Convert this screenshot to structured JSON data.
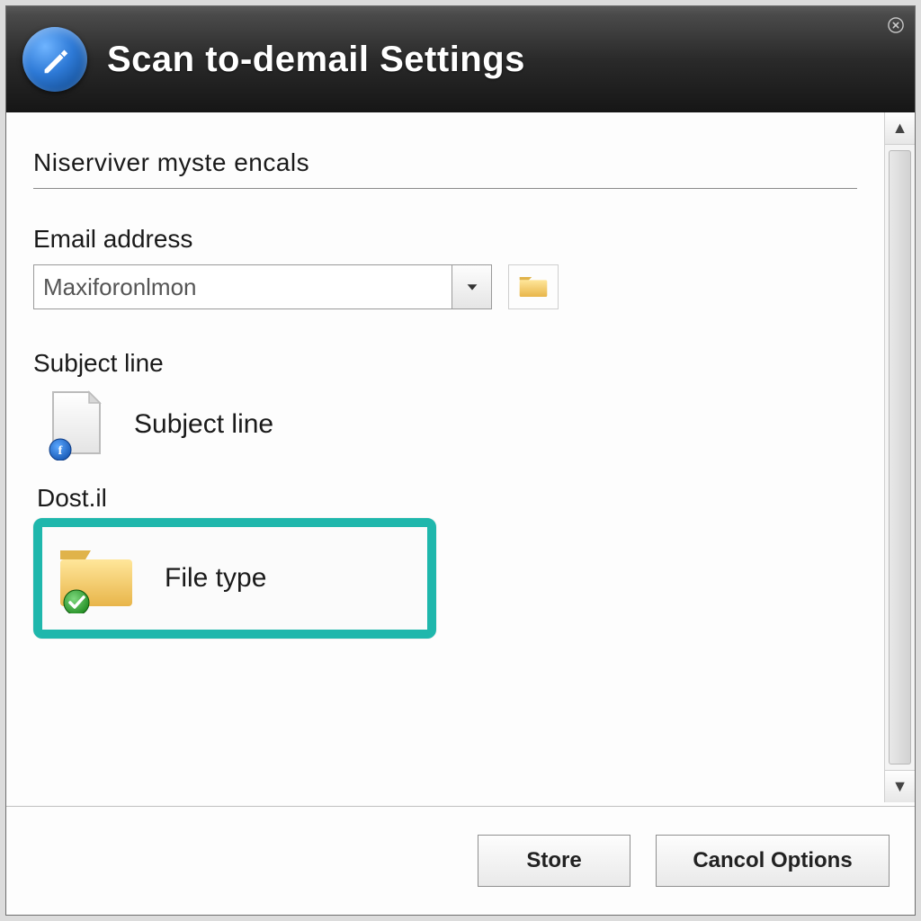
{
  "header": {
    "title": "Scan to-demail Settings",
    "icon": "pencil-scan-icon",
    "close_label": "close"
  },
  "section": {
    "heading": "Niserviver myste encals"
  },
  "email": {
    "label": "Email address",
    "value": "Maxiforonlmon",
    "browse_label": "browse-folder"
  },
  "subject": {
    "label": "Subject line",
    "item_label": "Subject line"
  },
  "destination": {
    "label": "Dost.il"
  },
  "filetype": {
    "label": "File type"
  },
  "buttons": {
    "store": "Store",
    "cancel": "Cancol Options"
  },
  "scrollbar": {
    "up": "▲",
    "down": "▼"
  },
  "colors": {
    "highlight": "#1fb7ac"
  }
}
